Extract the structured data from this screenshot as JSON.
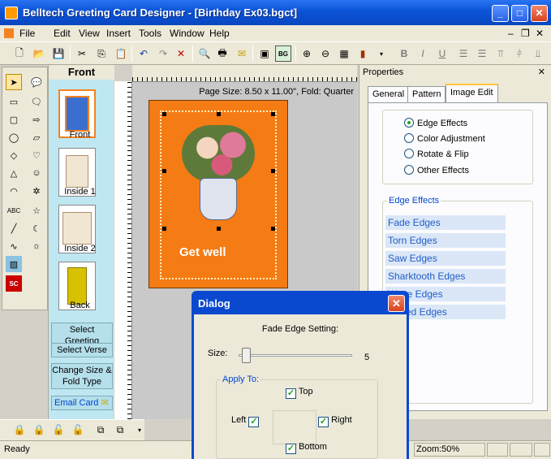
{
  "window": {
    "title": "Belltech Greeting Card Designer  - [Birthday Ex03.bgct]"
  },
  "menu": {
    "items": [
      "File",
      "Edit",
      "View",
      "Insert",
      "Tools",
      "Window",
      "Help"
    ]
  },
  "pages_panel": {
    "header": "Front",
    "thumbs": [
      {
        "label": "Front"
      },
      {
        "label": "Inside 1"
      },
      {
        "label": "Inside 2"
      },
      {
        "label": "Back"
      }
    ],
    "buttons": {
      "select_greeting": "Select Greeting",
      "select_verse": "Select Verse",
      "change_size": "Change Size & Fold Type",
      "email_card": "Email Card"
    }
  },
  "canvas": {
    "page_size": "Page Size: 8.50 x 11.00\", Fold: Quarter",
    "card_text": "Get well"
  },
  "properties": {
    "header": "Properties",
    "tabs": [
      "General",
      "Pattern",
      "Image Edit"
    ],
    "active_tab": "Image Edit",
    "options": [
      "Edge Effects",
      "Color Adjustment",
      "Rotate & Flip",
      "Other Effects"
    ],
    "selected_option": "Edge Effects",
    "edge_group_label": "Edge Effects",
    "edge_effects": [
      "Fade Edges",
      "Torn Edges",
      "Saw Edges",
      "Sharktooth Edges",
      "Wave Edges",
      "Curled Edges"
    ]
  },
  "dialog": {
    "title": "Dialog",
    "heading": "Fade Edge Setting:",
    "size_label": "Size:",
    "size_value": "5",
    "apply_label": "Apply To:",
    "top": "Top",
    "left": "Left",
    "right": "Right",
    "bottom": "Bottom",
    "checked": {
      "top": true,
      "left": true,
      "right": true,
      "bottom": true
    }
  },
  "status": {
    "ready": "Ready",
    "zoom": "Zoom:50%"
  },
  "colors": {
    "card": "#f57b14",
    "titlebar": "#0b53d6",
    "pages_panel": "#bfe7f2"
  }
}
